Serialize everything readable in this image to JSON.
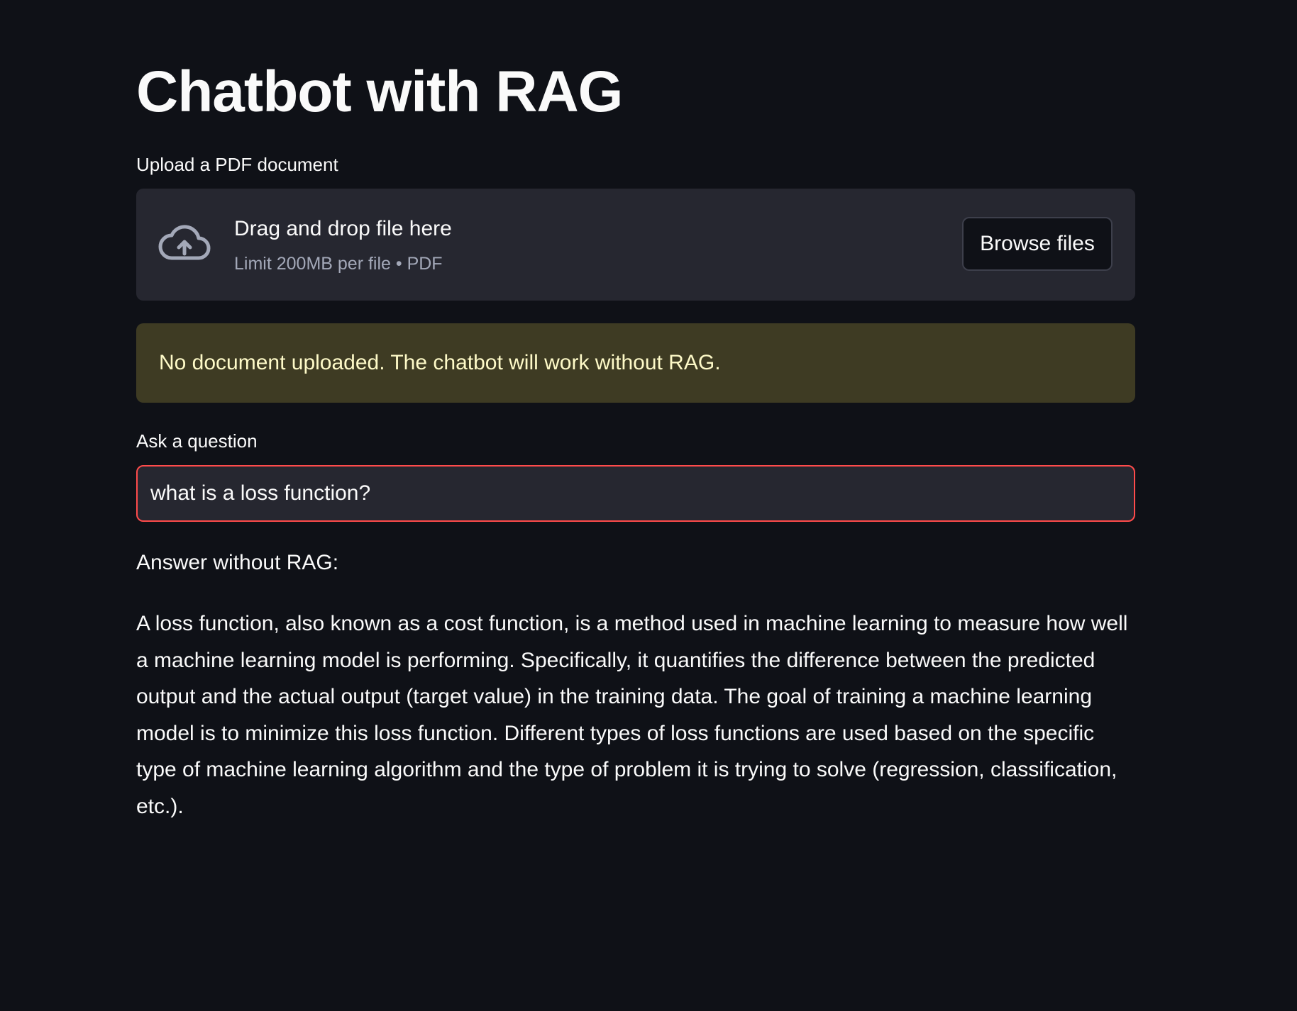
{
  "title": "Chatbot with RAG",
  "uploader": {
    "label": "Upload a PDF document",
    "drop_text": "Drag and drop file here",
    "limit_text": "Limit 200MB per file • PDF",
    "browse_label": "Browse files",
    "icon": "cloud-upload-icon"
  },
  "warning": {
    "text": "No document uploaded. The chatbot will work without RAG.",
    "background": "#3e3b23",
    "text_color": "#fefac8"
  },
  "question": {
    "label": "Ask a question",
    "value": "what is a loss function?",
    "focus_border_color": "#ff4b4b"
  },
  "answer": {
    "heading": "Answer without RAG:",
    "body": "A loss function, also known as a cost function, is a method used in machine learning to measure how well a machine learning model is performing. Specifically, it quantifies the difference between the predicted output and the actual output (target value) in the training data. The goal of training a machine learning model is to minimize this loss function. Different types of loss functions are used based on the specific type of machine learning algorithm and the type of problem it is trying to solve (regression, classification, etc.)."
  },
  "colors": {
    "background": "#0f1117",
    "surface": "#262730",
    "text": "#fafafa"
  }
}
